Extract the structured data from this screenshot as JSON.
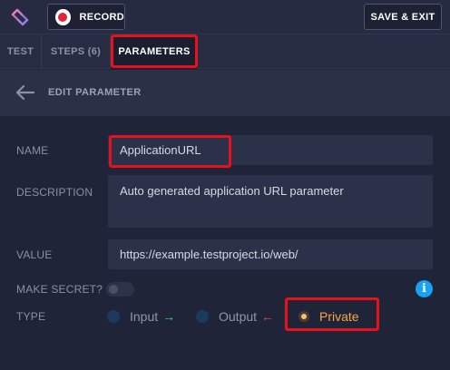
{
  "toolbar": {
    "record_label": "RECORD",
    "save_exit_label": "SAVE & EXIT"
  },
  "tabs": [
    {
      "label": "TEST"
    },
    {
      "label": "STEPS (6)"
    },
    {
      "label": "PARAMETERS",
      "active": true
    }
  ],
  "edit": {
    "title": "EDIT PARAMETER"
  },
  "form": {
    "name_label": "NAME",
    "name_value": "ApplicationURL",
    "description_label": "DESCRIPTION",
    "description_value": "Auto generated application URL parameter",
    "value_label": "VALUE",
    "value_value": "https://example.testproject.io/web/",
    "secret_label": "MAKE SECRET?",
    "secret_on": false,
    "type_label": "TYPE",
    "type_options": [
      {
        "label": "Input",
        "arrow": "→",
        "arrow_color": "#3ecf6e"
      },
      {
        "label": "Output",
        "arrow": "←",
        "arrow_color": "#e5484d"
      },
      {
        "label": "Private",
        "selected": true
      }
    ]
  },
  "colors": {
    "background": "#1f2439",
    "accent_highlight": "#e8101a",
    "info": "#19a2f0",
    "private": "#f7a548"
  },
  "icons": [
    "app-logo-icon",
    "record-icon",
    "back-arrow-icon",
    "info-icon"
  ]
}
